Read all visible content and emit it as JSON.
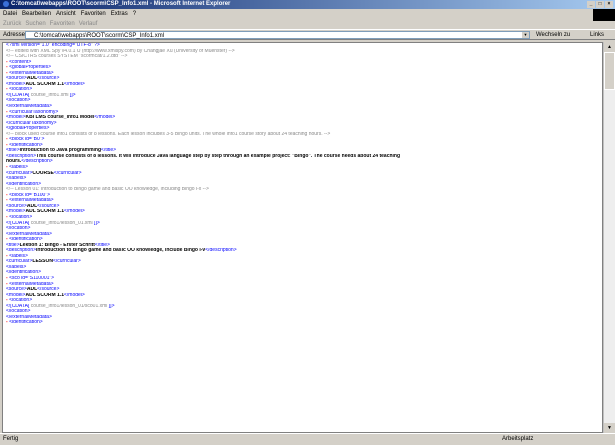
{
  "window": {
    "title": "C:\\tomcat\\webapps\\ROOT\\scorm\\CSP_Info1.xml - Microsoft Internet Explorer"
  },
  "menu": [
    "Datei",
    "Bearbeiten",
    "Ansicht",
    "Favoriten",
    "Extras",
    "?"
  ],
  "toolbar": [
    "Zurück",
    "Suchen",
    "Favoriten",
    "Verlauf"
  ],
  "address": {
    "label": "Adresse",
    "value": "C:\\tomcat\\webapps\\ROOT\\scorm\\CSP_Info1.xml",
    "go_label": "Wechseln zu",
    "links_label": "Links"
  },
  "status": {
    "left": "Fertig",
    "zone": "Arbeitsplatz"
  },
  "xml_lines": [
    [
      [
        "t",
        "<?xml version=\"1.0\" encoding=\"UTF-8\" ?>"
      ]
    ],
    [
      [
        "c",
        "<!-- edited with XML Spy v4.0.1 U (http://www.xmlspy.com) by Changjae Xu (University of Muenster) -->"
      ]
    ],
    [
      [
        "c",
        "<!-- CSICTRS courses SYSTEM \"scormcat/1.2.dtd\" -->"
      ]
    ],
    [
      [
        "m",
        "- "
      ],
      [
        "t",
        "<content>"
      ]
    ],
    [
      [
        "m",
        "  - "
      ],
      [
        "t",
        "<globalProperties>"
      ]
    ],
    [
      [
        "m",
        "    - "
      ],
      [
        "t",
        "<externalMetadata>"
      ]
    ],
    [
      [
        "t",
        "        <source>"
      ],
      [
        "b",
        "ADL"
      ],
      [
        "t",
        "</source>"
      ]
    ],
    [
      [
        "t",
        "        <model>"
      ],
      [
        "b",
        "ADL SCORM 1.1"
      ],
      [
        "t",
        "</model>"
      ]
    ],
    [
      [
        "m",
        "      - "
      ],
      [
        "t",
        "<location>"
      ]
    ],
    [
      [
        "t",
        "          <![CDATA[ "
      ],
      [
        "c",
        "course_info1.xml"
      ],
      [
        "t",
        " ]]>"
      ]
    ],
    [
      [
        "t",
        "        </location>"
      ]
    ],
    [
      [
        "t",
        "      </externalMetadata>"
      ]
    ],
    [
      [
        "m",
        "    - "
      ],
      [
        "t",
        "<curricularTaxonomy>"
      ]
    ],
    [
      [
        "t",
        "        <model>"
      ],
      [
        "b",
        "KBI LMS course_info1 Model"
      ],
      [
        "t",
        "</model>"
      ]
    ],
    [
      [
        "t",
        "      </curricularTaxonomy>"
      ]
    ],
    [
      [
        "t",
        "    </globalProperties>"
      ]
    ],
    [
      [
        "c",
        "    <!-- block used course info1 consists of 8 lessons. Each lesson includes 3-5 Bingo units. The whole info1 course story about 24 teaching hours. -->"
      ]
    ],
    [
      [
        "m",
        "  - "
      ],
      [
        "t",
        "<block id=\"B0\">"
      ]
    ],
    [
      [
        "m",
        "    - "
      ],
      [
        "t",
        "<identification>"
      ]
    ],
    [
      [
        "t",
        "        <title>"
      ],
      [
        "b",
        "Introduction to Java programming"
      ],
      [
        "t",
        "</title>"
      ]
    ],
    [
      [
        "t",
        "        <description>"
      ],
      [
        "b",
        "This course consists of 8 lessons. It will introduce Java language step by step through an example project: \"Bingo\". The course needs about 24 teaching"
      ]
    ],
    [
      [
        "b",
        "          hours."
      ],
      [
        "t",
        "</description>"
      ]
    ],
    [
      [
        "m",
        "      - "
      ],
      [
        "t",
        "<labels>"
      ]
    ],
    [
      [
        "t",
        "          <curricular>"
      ],
      [
        "b",
        "COURSE"
      ],
      [
        "t",
        "</curricular>"
      ]
    ],
    [
      [
        "t",
        "        </labels>"
      ]
    ],
    [
      [
        "t",
        "      </identification>"
      ]
    ],
    [
      [
        "c",
        "    <!-- Lesson 01: Introduction to Bingo game and basic OO knowledge, including Bingo i-x -->"
      ]
    ],
    [
      [
        "m",
        "    - "
      ],
      [
        "t",
        "<block id=\"B100\">"
      ]
    ],
    [
      [
        "m",
        "      - "
      ],
      [
        "t",
        "<externalMetadata>"
      ]
    ],
    [
      [
        "t",
        "          <source>"
      ],
      [
        "b",
        "ADL"
      ],
      [
        "t",
        "</source>"
      ]
    ],
    [
      [
        "t",
        "          <model>"
      ],
      [
        "b",
        "ADL SCORM 1.1"
      ],
      [
        "t",
        "</model>"
      ]
    ],
    [
      [
        "m",
        "        - "
      ],
      [
        "t",
        "<location>"
      ]
    ],
    [
      [
        "t",
        "            <![CDATA[ "
      ],
      [
        "c",
        "course_info1/lesson_01.xml"
      ],
      [
        "t",
        " ]]>"
      ]
    ],
    [
      [
        "t",
        "          </location>"
      ]
    ],
    [
      [
        "t",
        "        </externalMetadata>"
      ]
    ],
    [
      [
        "m",
        "      - "
      ],
      [
        "t",
        "<identification>"
      ]
    ],
    [
      [
        "t",
        "          <title>"
      ],
      [
        "b",
        "Lektion 1: Bingo - Erster Schritt"
      ],
      [
        "t",
        "</title>"
      ]
    ],
    [
      [
        "t",
        "          <description>"
      ],
      [
        "b",
        "Introduction to Bingo game and basic OO knowledge, include Bingo i-v"
      ],
      [
        "t",
        "</description>"
      ]
    ],
    [
      [
        "m",
        "        - "
      ],
      [
        "t",
        "<labels>"
      ]
    ],
    [
      [
        "t",
        "            <curricular>"
      ],
      [
        "b",
        "LESSON"
      ],
      [
        "t",
        "</curricular>"
      ]
    ],
    [
      [
        "t",
        "          </labels>"
      ]
    ],
    [
      [
        "t",
        "        </identification>"
      ]
    ],
    [
      [
        "m",
        "      - "
      ],
      [
        "t",
        "<sco id=\"S110001\">"
      ]
    ],
    [
      [
        "m",
        "        - "
      ],
      [
        "t",
        "<externalMetadata>"
      ]
    ],
    [
      [
        "t",
        "            <source>"
      ],
      [
        "b",
        "ADL"
      ],
      [
        "t",
        "</source>"
      ]
    ],
    [
      [
        "t",
        "            <model>"
      ],
      [
        "b",
        "ADL SCORM 1.1"
      ],
      [
        "t",
        "</model>"
      ]
    ],
    [
      [
        "m",
        "          - "
      ],
      [
        "t",
        "<location>"
      ]
    ],
    [
      [
        "t",
        "              <![CDATA[ "
      ],
      [
        "c",
        "course_info1/lesson_01/sco01.xml"
      ],
      [
        "t",
        " ]]>"
      ]
    ],
    [
      [
        "t",
        "            </location>"
      ]
    ],
    [
      [
        "t",
        "          </externalMetadata>"
      ]
    ],
    [
      [
        "m",
        "        - "
      ],
      [
        "t",
        "<identification>"
      ]
    ]
  ]
}
